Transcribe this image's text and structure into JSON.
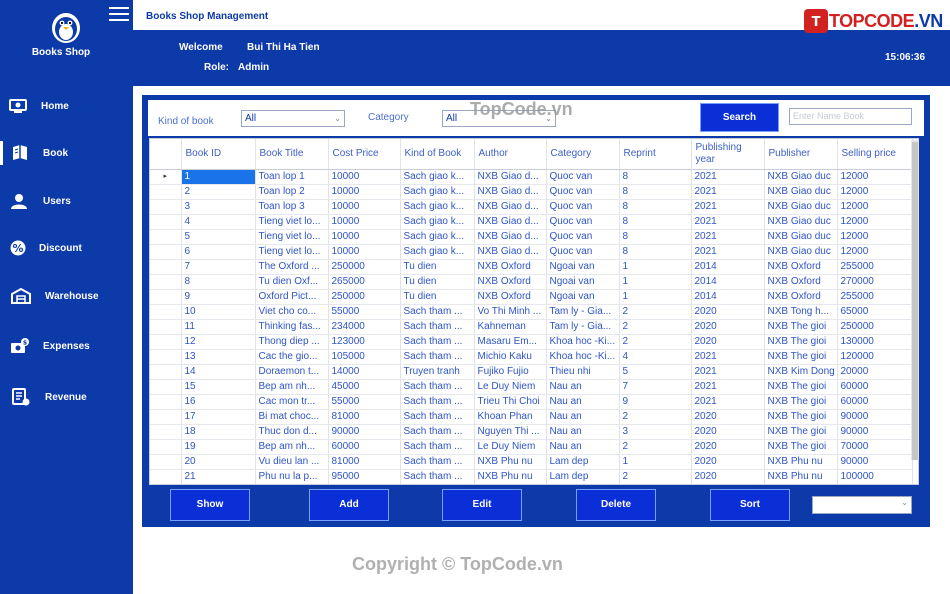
{
  "sidebar": {
    "brand": "Books Shop",
    "items": [
      {
        "label": "Home",
        "icon": "home-icon"
      },
      {
        "label": "Book",
        "icon": "book-icon"
      },
      {
        "label": "Users",
        "icon": "users-icon"
      },
      {
        "label": "Discount",
        "icon": "discount-icon"
      },
      {
        "label": "Warehouse",
        "icon": "warehouse-icon"
      },
      {
        "label": "Expenses",
        "icon": "expenses-icon"
      },
      {
        "label": "Revenue",
        "icon": "revenue-icon"
      }
    ],
    "active": "Book"
  },
  "header": {
    "title": "Books Shop Management",
    "welcome_label": "Welcome",
    "welcome_name": "Bui Thi Ha Tien",
    "role_label": "Role:",
    "role_value": "Admin",
    "time": "15:06:36",
    "brand_logo_text": "TOPCODE.VN"
  },
  "filters": {
    "kind_label": "Kind of book",
    "kind_value": "All",
    "category_label": "Category",
    "category_value": "All",
    "search_button": "Search",
    "search_placeholder": "Enter Name Book"
  },
  "table": {
    "columns": [
      "Book ID",
      "Book Title",
      "Cost Price",
      "Kind of Book",
      "Author",
      "Category",
      "Reprint",
      "Publishing year",
      "Publisher",
      "Selling price"
    ],
    "rows": [
      [
        "1",
        "Toan lop 1",
        "10000",
        "Sach giao k...",
        "NXB Giao d...",
        "Quoc van",
        "8",
        "2021",
        "NXB Giao duc",
        "12000"
      ],
      [
        "2",
        "Toan lop 2",
        "10000",
        "Sach giao k...",
        "NXB Giao d...",
        "Quoc van",
        "8",
        "2021",
        "NXB Giao duc",
        "12000"
      ],
      [
        "3",
        "Toan lop 3",
        "10000",
        "Sach giao k...",
        "NXB Giao d...",
        "Quoc van",
        "8",
        "2021",
        "NXB Giao duc",
        "12000"
      ],
      [
        "4",
        "Tieng viet lo...",
        "10000",
        "Sach giao k...",
        "NXB Giao d...",
        "Quoc van",
        "8",
        "2021",
        "NXB Giao duc",
        "12000"
      ],
      [
        "5",
        "Tieng viet lo...",
        "10000",
        "Sach giao k...",
        "NXB Giao d...",
        "Quoc van",
        "8",
        "2021",
        "NXB Giao duc",
        "12000"
      ],
      [
        "6",
        "Tieng viet lo...",
        "10000",
        "Sach giao k...",
        "NXB Giao d...",
        "Quoc van",
        "8",
        "2021",
        "NXB Giao duc",
        "12000"
      ],
      [
        "7",
        "The Oxford ...",
        "250000",
        "Tu dien",
        "NXB Oxford",
        "Ngoai van",
        "1",
        "2014",
        "NXB Oxford",
        "255000"
      ],
      [
        "8",
        "Tu dien Oxf...",
        "265000",
        "Tu dien",
        "NXB Oxford",
        "Ngoai van",
        "1",
        "2014",
        "NXB Oxford",
        "270000"
      ],
      [
        "9",
        "Oxford Pict...",
        "250000",
        "Tu dien",
        "NXB Oxford",
        "Ngoai van",
        "1",
        "2014",
        "NXB Oxford",
        "255000"
      ],
      [
        "10",
        "Viet cho co...",
        "55000",
        "Sach tham ...",
        "Vo Thi Minh ...",
        "Tam ly - Gia...",
        "2",
        "2020",
        "NXB Tong h...",
        "65000"
      ],
      [
        "11",
        "Thinking fas...",
        "234000",
        "Sach tham ...",
        "Kahneman",
        "Tam ly - Gia...",
        "2",
        "2020",
        "NXB The gioi",
        "250000"
      ],
      [
        "12",
        "Thong diep ...",
        "123000",
        "Sach tham ...",
        "Masaru Em...",
        "Khoa hoc -Ki...",
        "2",
        "2020",
        "NXB The gioi",
        "130000"
      ],
      [
        "13",
        "Cac the gio...",
        "105000",
        "Sach tham ...",
        "Michio Kaku",
        "Khoa hoc -Ki...",
        "4",
        "2021",
        "NXB The gioi",
        "120000"
      ],
      [
        "14",
        "Doraemon t...",
        "14000",
        "Truyen tranh",
        "Fujiko Fujio",
        "Thieu nhi",
        "5",
        "2021",
        "NXB Kim Dong",
        "20000"
      ],
      [
        "15",
        "Bep am nh...",
        "45000",
        "Sach tham ...",
        "Le Duy Niem",
        "Nau an",
        "7",
        "2021",
        "NXB The gioi",
        "60000"
      ],
      [
        "16",
        "Cac mon tr...",
        "55000",
        "Sach tham ...",
        "Trieu Thi Choi",
        "Nau an",
        "9",
        "2021",
        "NXB The gioi",
        "60000"
      ],
      [
        "17",
        "Bi mat choc...",
        "81000",
        "Sach tham ...",
        "Khoan Phan",
        "Nau an",
        "2",
        "2020",
        "NXB The gioi",
        "90000"
      ],
      [
        "18",
        "Thuc don d...",
        "90000",
        "Sach tham ...",
        "Nguyen Thi ...",
        "Nau an",
        "3",
        "2020",
        "NXB The gioi",
        "90000"
      ],
      [
        "19",
        "Bep am nh...",
        "60000",
        "Sach tham ...",
        "Le Duy Niem",
        "Nau an",
        "2",
        "2020",
        "NXB The gioi",
        "70000"
      ],
      [
        "20",
        "Vu dieu lan ...",
        "81000",
        "Sach tham ...",
        "NXB Phu nu",
        "Lam dep",
        "1",
        "2020",
        "NXB Phu nu",
        "90000"
      ],
      [
        "21",
        "Phu nu la p...",
        "95000",
        "Sach tham ...",
        "NXB Phu nu",
        "Lam dep",
        "2",
        "2020",
        "NXB Phu nu",
        "100000"
      ]
    ],
    "selected_row": 0
  },
  "actions": {
    "show": "Show",
    "add": "Add",
    "edit": "Edit",
    "delete": "Delete",
    "sort": "Sort"
  },
  "watermarks": {
    "top": "TopCode.vn",
    "bottom": "Copyright © TopCode.vn"
  },
  "colors": {
    "primary": "#0d3aa9",
    "button": "#0a2fd6",
    "selection": "#1a73e8",
    "text_blue": "#2f55c6"
  }
}
